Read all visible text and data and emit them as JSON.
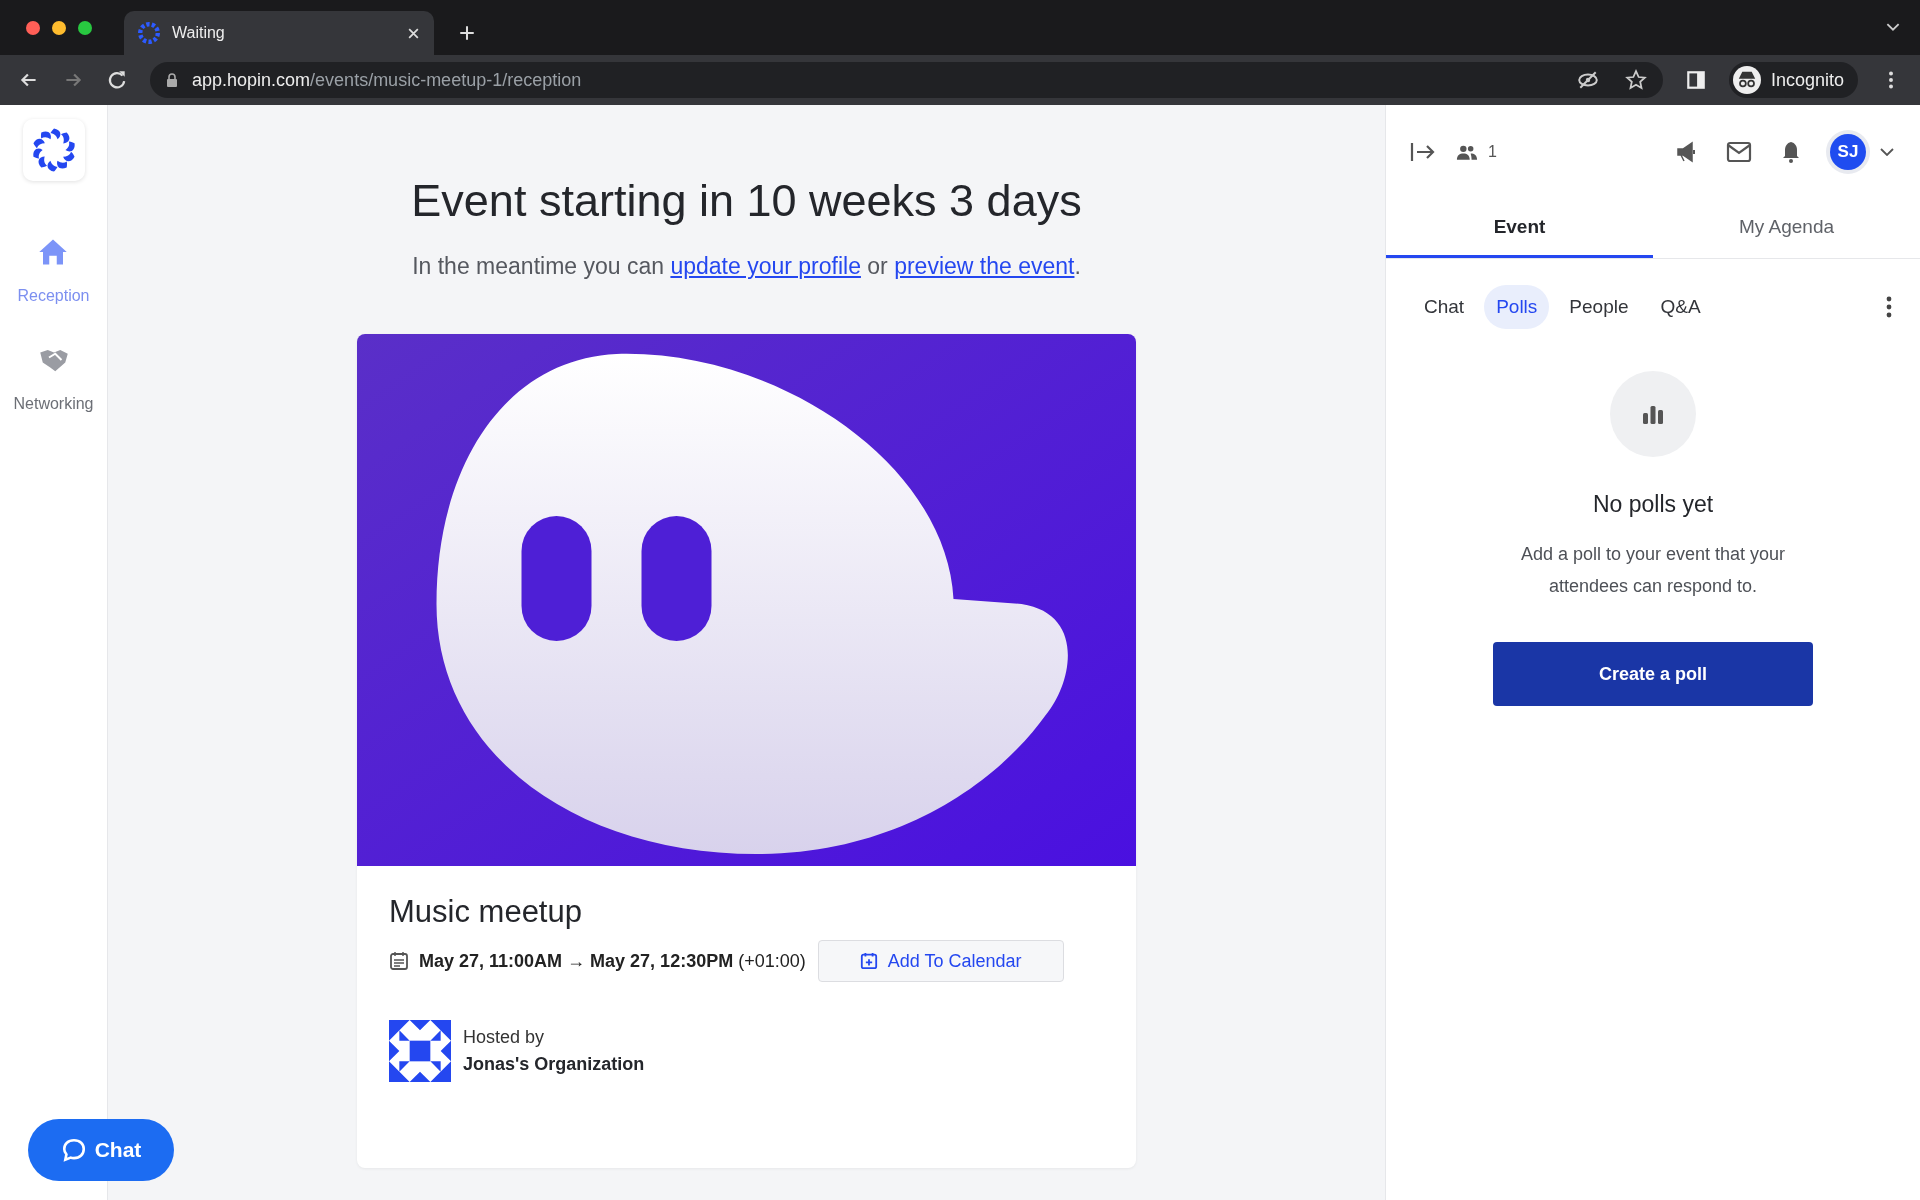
{
  "browser": {
    "tab_title": "Waiting",
    "url_host": "app.hopin.com",
    "url_path": "/events/music-meetup-1/reception",
    "profile": "Incognito"
  },
  "sidebar": {
    "items": [
      {
        "label": "Reception",
        "kind": "home",
        "selected": true
      },
      {
        "label": "Networking",
        "kind": "handshake",
        "selected": false
      }
    ]
  },
  "main": {
    "heading": "Event starting in 10 weeks 3 days",
    "intro": [
      {
        "text": "In the meantime you can ",
        "link": false
      },
      {
        "text": "update your profile",
        "link": true
      },
      {
        "text": " or ",
        "link": false
      },
      {
        "text": "preview the event",
        "link": true
      },
      {
        "text": ".",
        "link": false
      }
    ],
    "card": {
      "title": "Music meetup",
      "date": "**May 27, 11:00AM → May 27, 12:30PM** (+01:00)",
      "add_to_calendar": "Add To Calendar",
      "hosted_by": "Hosted by",
      "host": "Jonas's Organization"
    }
  },
  "chat_button": "Chat",
  "panel": {
    "people_count": "1",
    "avatar": "SJ",
    "tabs": [
      {
        "label": "Event",
        "selected": true
      },
      {
        "label": "My Agenda",
        "selected": false
      }
    ],
    "subtabs": [
      {
        "label": "Chat",
        "selected": false
      },
      {
        "label": "Polls",
        "selected": true
      },
      {
        "label": "People",
        "selected": false
      },
      {
        "label": "Q&A",
        "selected": false
      }
    ],
    "empty_title": "No polls yet",
    "empty_text": "Add a poll to your event that your attendees can respond to.",
    "create_button": "Create a poll"
  }
}
